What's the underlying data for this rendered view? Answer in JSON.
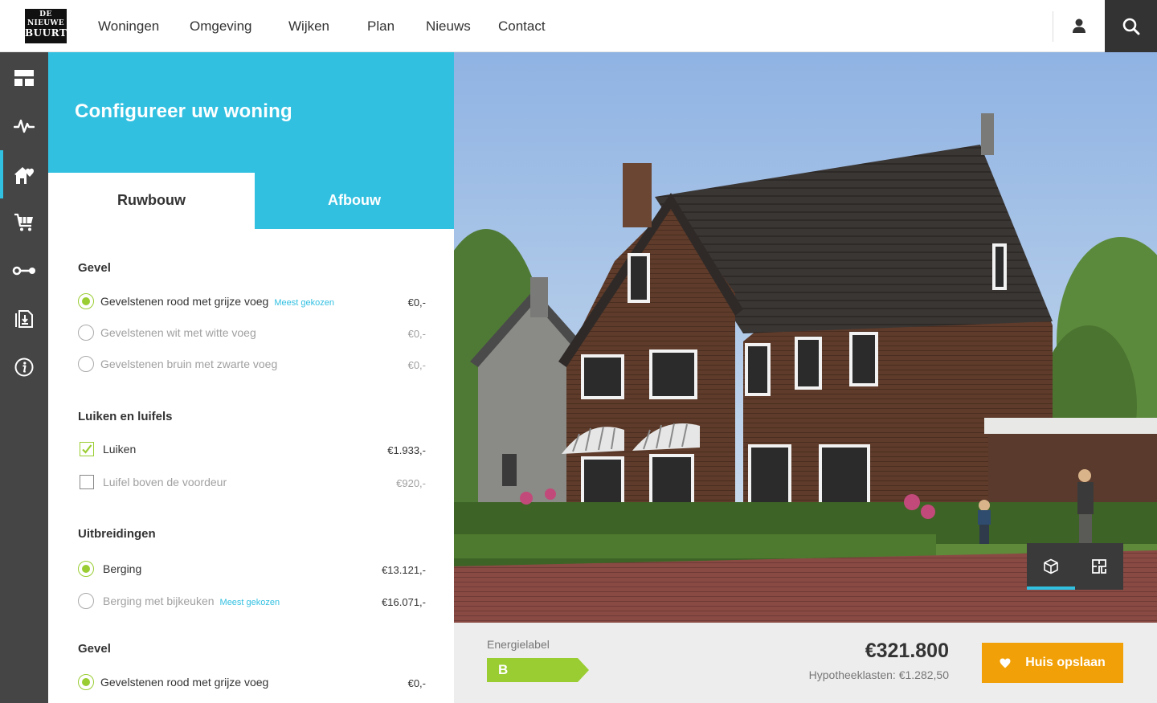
{
  "brand": {
    "logo_line1": "DE",
    "logo_line2": "NIEUWE",
    "logo_line3": "BUURT"
  },
  "nav": {
    "items": [
      "Woningen",
      "Omgeving",
      "Wijken",
      "Plan",
      "Nieuws",
      "Contact"
    ],
    "user_icon": "user-icon",
    "search_icon": "search-icon"
  },
  "sidebar": {
    "items": [
      {
        "icon": "layout-icon"
      },
      {
        "icon": "activity-icon"
      },
      {
        "icon": "home-heart-icon",
        "active": true
      },
      {
        "icon": "cart-icon"
      },
      {
        "icon": "key-icon"
      },
      {
        "icon": "document-download-icon"
      },
      {
        "icon": "info-icon"
      }
    ]
  },
  "config": {
    "title": "Configureer uw woning",
    "tabs": [
      "Ruwbouw",
      "Afbouw"
    ],
    "active_tab": "Ruwbouw",
    "sections": [
      {
        "title": "Gevel",
        "options": [
          {
            "type": "radio",
            "label": "Gevelstenen rood met grijze voeg",
            "badge": "Meest gekozen",
            "price": "€0,-",
            "selected": true
          },
          {
            "type": "radio",
            "label": "Gevelstenen wit met witte voeg",
            "badge": "",
            "price": "€0,-",
            "selected": false
          },
          {
            "type": "radio",
            "label": "Gevelstenen bruin met zwarte voeg",
            "badge": "",
            "price": "€0,-",
            "selected": false
          }
        ]
      },
      {
        "title": "Luiken en luifels",
        "options": [
          {
            "type": "checkbox",
            "label": "Luiken",
            "badge": "",
            "price": "€1.933,-",
            "selected": true
          },
          {
            "type": "checkbox",
            "label": "Luifel boven de voordeur",
            "badge": "",
            "price": "€920,-",
            "selected": false
          }
        ]
      },
      {
        "title": "Uitbreidingen",
        "options": [
          {
            "type": "radio",
            "label": "Berging",
            "badge": "",
            "price": "€13.121,-",
            "selected": true
          },
          {
            "type": "radio",
            "label": "Berging met bijkeuken",
            "badge": "Meest gekozen",
            "price": "€16.071,-",
            "selected": false
          }
        ]
      },
      {
        "title": "Gevel",
        "options": [
          {
            "type": "radio",
            "label": "Gevelstenen rood met grijze voeg",
            "badge": "",
            "price": "€0,-",
            "selected": true
          }
        ]
      }
    ]
  },
  "preview": {
    "view_modes": [
      "3d-cube-icon",
      "floorplan-icon"
    ],
    "active_view": "3d-cube-icon"
  },
  "summary": {
    "energy_label_title": "Energielabel",
    "energy_label_value": "B",
    "energy_color": "#9acd32",
    "price": "€321.800",
    "mortgage": "Hypotheeklasten: €1.282,50",
    "save_label": "Huis opslaan",
    "save_color": "#f2a007"
  },
  "colors": {
    "accent": "#32c0e1",
    "sidebar": "#454545",
    "selected": "#9acd32"
  }
}
